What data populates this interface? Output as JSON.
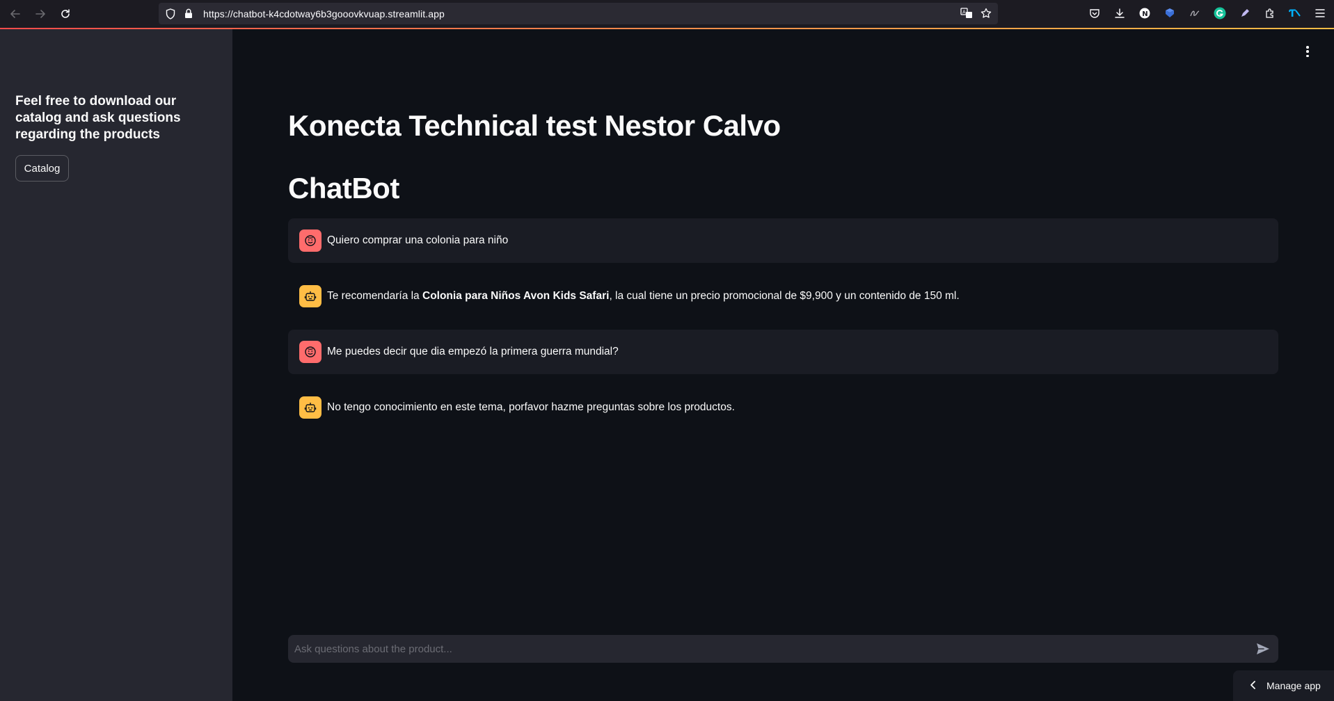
{
  "browser": {
    "url": "https://chatbot-k4cdotway6b3gooovkvuap.streamlit.app",
    "back_icon": "arrow-left-icon",
    "forward_icon": "arrow-right-icon",
    "reload_icon": "reload-icon"
  },
  "sidebar": {
    "title": "Feel free to download our catalog and ask questions regarding the products",
    "catalog_button": "Catalog"
  },
  "main": {
    "title": "Konecta Technical test Nestor Calvo",
    "subtitle": "ChatBot",
    "messages": [
      {
        "role": "user",
        "text": "Quiero comprar una colonia para niño"
      },
      {
        "role": "assistant",
        "text_before": "Te recomendaría la ",
        "text_bold": "Colonia para Niños Avon Kids Safari",
        "text_after": ", la cual tiene un precio promocional de $9,900 y un contenido de 150 ml."
      },
      {
        "role": "user",
        "text": "Me puedes decir que dia empezó la primera guerra mundial?"
      },
      {
        "role": "assistant",
        "text": "No tengo conocimiento en este tema, porfavor hazme preguntas sobre los productos."
      }
    ],
    "chat_input": {
      "placeholder": "Ask questions about the product...",
      "value": ""
    }
  },
  "manage_app": {
    "label": "Manage app"
  },
  "colors": {
    "sidebar_bg": "#262730",
    "main_bg": "#0e1117",
    "user_avatar": "#ff6c6c",
    "bot_avatar": "#ffbd45"
  }
}
